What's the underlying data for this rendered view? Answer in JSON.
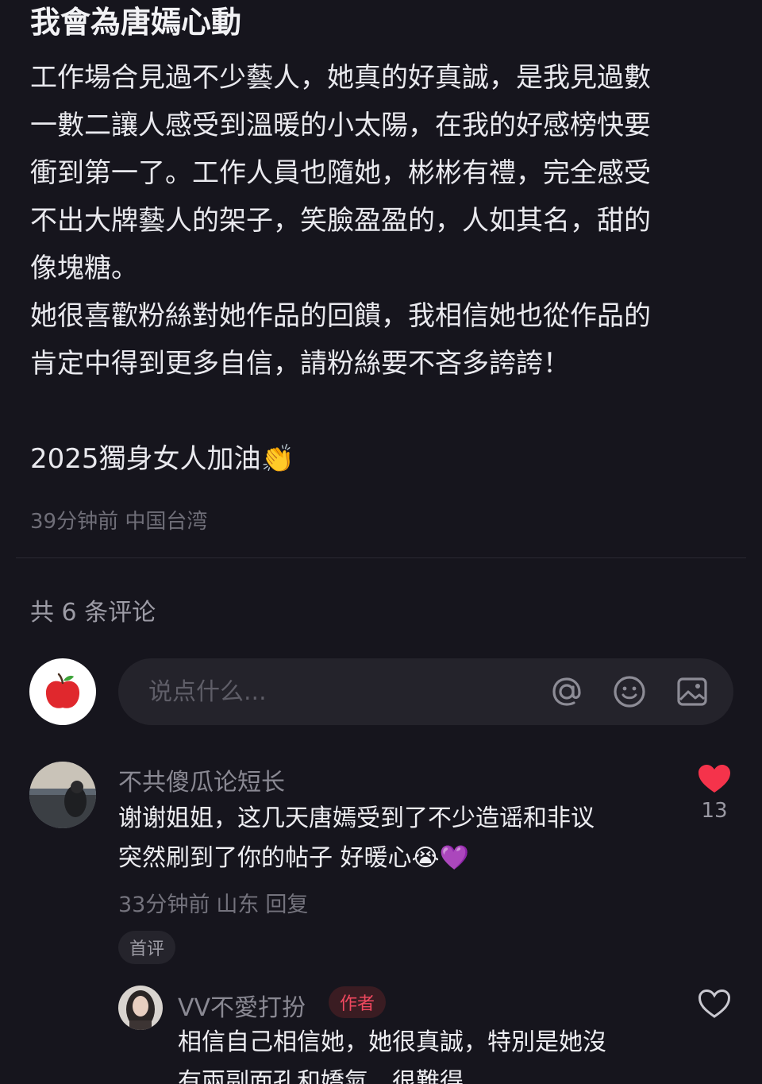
{
  "post": {
    "title": "我會為唐嫣心動",
    "body_lines": [
      "工作場合見過不少藝人，她真的好真誠，是我見過數",
      "一數二讓人感受到溫暖的小太陽，在我的好感榜快要",
      "衝到第一了。工作人員也隨她，彬彬有禮，完全感受",
      "不出大牌藝人的架子，笑臉盈盈的，人如其名，甜的",
      "像塊糖。",
      "她很喜歡粉絲對她作品的回饋，我相信她也從作品的",
      "肯定中得到更多自信，請粉絲要不吝多誇誇！"
    ],
    "closing": "2025獨身女人加油",
    "closing_emoji": "👏",
    "time": "39分钟前",
    "location": "中国台湾"
  },
  "comments_header": "共 6 条评论",
  "input": {
    "placeholder": "说点什么...",
    "icons": [
      "at-icon",
      "emoji-icon",
      "image-icon"
    ]
  },
  "comments": [
    {
      "username": "不共傻瓜论短长",
      "lines": [
        "谢谢姐姐，这几天唐嫣受到了不少造谣和非议",
        "突然刷到了你的帖子 好暖心😭💜"
      ],
      "time": "33分钟前",
      "location": "山东",
      "reply_label": "回复",
      "badge": "首评",
      "likes": "13",
      "liked": true
    },
    {
      "username": "VV不愛打扮",
      "badge": "作者",
      "lines": [
        "相信自己相信她，她很真誠，特別是她沒",
        "有兩副面孔和嬌氣，很難得"
      ],
      "liked": false
    }
  ],
  "colors": {
    "background": "#16151d",
    "like_red": "#f5334b",
    "author_badge": "#f0485f"
  }
}
